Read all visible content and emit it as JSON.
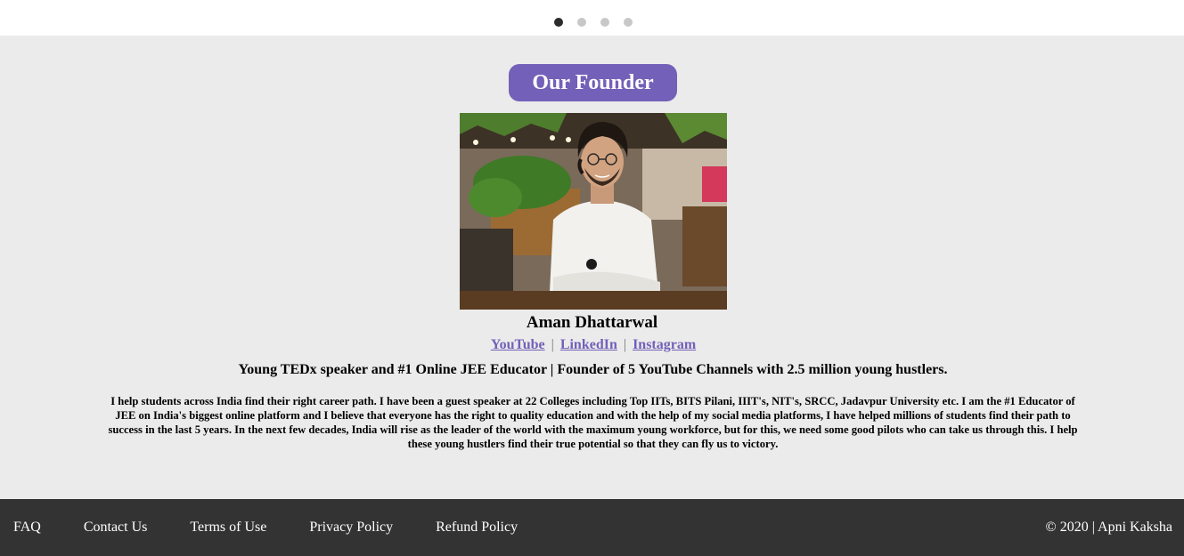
{
  "carousel": {
    "dots": [
      {
        "active": true
      },
      {
        "active": false
      },
      {
        "active": false
      },
      {
        "active": false
      }
    ]
  },
  "founder": {
    "heading": "Our Founder",
    "name": "Aman Dhattarwal",
    "links": {
      "youtube": "YouTube",
      "separator": "|",
      "linkedin": "LinkedIn",
      "instagram": "Instagram"
    },
    "tagline": "Young TEDx speaker and #1 Online JEE Educator | Founder of 5 YouTube Channels with 2.5 million young hustlers.",
    "bio": "I help students across India find their right career path. I have been a guest speaker at 22 Colleges including Top IITs, BITS Pilani, IIIT's, NIT's, SRCC, Jadavpur University etc. I am the #1 Educator of JEE on India's biggest online platform and I believe that everyone has the right to quality education and with the help of my social media platforms, I have helped millions of students find their path to success in the last 5 years. In the next few decades, India will rise as the leader of the world with the maximum young workforce, but for this, we need some good pilots who can take us through this. I help these young hustlers find their true potential so that they can fly us to victory."
  },
  "footer": {
    "faq": "FAQ",
    "contact": "Contact Us",
    "terms": "Terms of Use",
    "privacy": "Privacy Policy",
    "refund": "Refund Policy",
    "copyright": "© 2020 | Apni Kaksha"
  },
  "colors": {
    "accent": "#7360b8",
    "section_bg": "#ebebeb",
    "footer_bg": "#333333"
  }
}
